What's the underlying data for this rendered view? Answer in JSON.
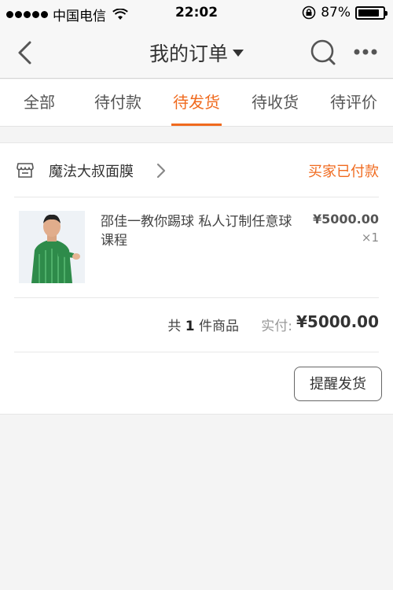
{
  "status_bar": {
    "carrier": "中国电信",
    "time": "22:02",
    "battery_percent": "87%",
    "battery_level": 0.87
  },
  "nav": {
    "title": "我的订单"
  },
  "tabs": [
    {
      "label": "全部",
      "active": false
    },
    {
      "label": "待付款",
      "active": false
    },
    {
      "label": "待发货",
      "active": true
    },
    {
      "label": "待收货",
      "active": false
    },
    {
      "label": "待评价",
      "active": false
    }
  ],
  "order": {
    "shop_name": "魔法大叔面膜",
    "status": "买家已付款",
    "item": {
      "title": "邵佳一教你踢球 私人订制任意球课程",
      "price": "¥5000.00",
      "quantity": "×1"
    },
    "summary": {
      "prefix": "共",
      "count": "1",
      "suffix": "件商品",
      "paid_label": "实付:",
      "total": "¥5000.00"
    },
    "action_label": "提醒发货"
  },
  "colors": {
    "accent": "#f06a1e",
    "background": "#f4f4f4"
  }
}
